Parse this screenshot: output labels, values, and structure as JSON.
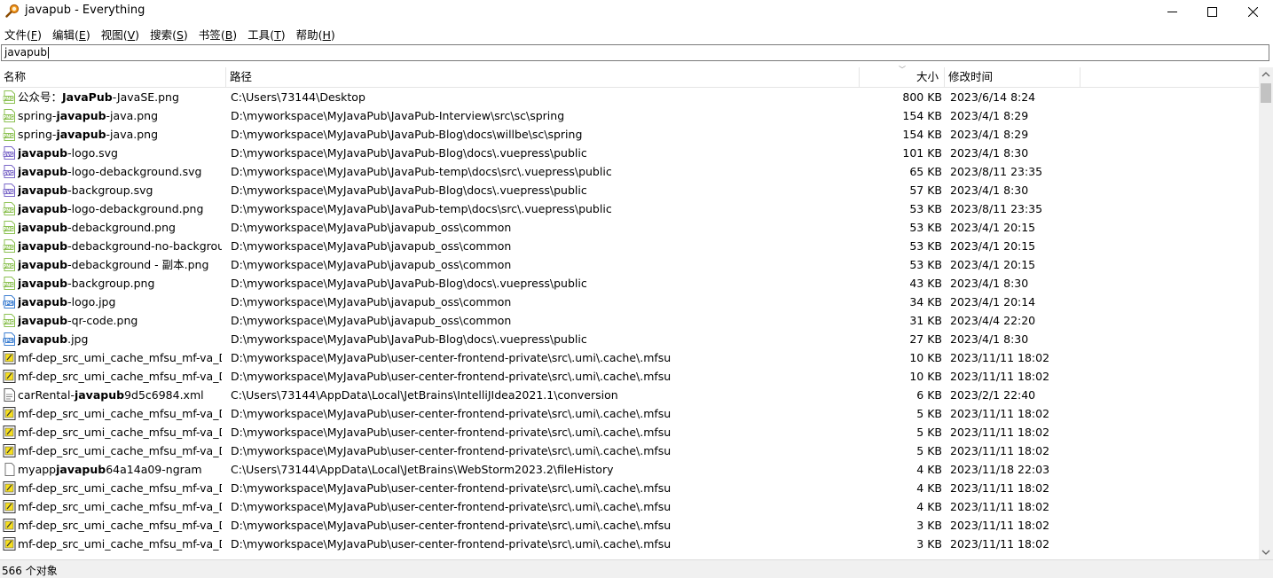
{
  "window": {
    "title": "javapub - Everything"
  },
  "menu": [
    {
      "label": "文件",
      "key": "F"
    },
    {
      "label": "编辑",
      "key": "E"
    },
    {
      "label": "视图",
      "key": "V"
    },
    {
      "label": "搜索",
      "key": "S"
    },
    {
      "label": "书签",
      "key": "B"
    },
    {
      "label": "工具",
      "key": "T"
    },
    {
      "label": "帮助",
      "key": "H"
    }
  ],
  "search": {
    "value": "javapub"
  },
  "columns": {
    "name": "名称",
    "path": "路径",
    "size": "大小",
    "modified": "修改时间"
  },
  "rows": [
    {
      "icon": "png",
      "pre": "公众号：",
      "hl": "JavaPub",
      "post": "-JavaSE.png",
      "path": "C:\\Users\\73144\\Desktop",
      "size": "800 KB",
      "date": "2023/6/14 8:24"
    },
    {
      "icon": "png",
      "pre": "spring-",
      "hl": "javapub",
      "post": "-java.png",
      "path": "D:\\myworkspace\\MyJavaPub\\JavaPub-Interview\\src\\sc\\spring",
      "size": "154 KB",
      "date": "2023/4/1 8:29"
    },
    {
      "icon": "png",
      "pre": "spring-",
      "hl": "javapub",
      "post": "-java.png",
      "path": "D:\\myworkspace\\MyJavaPub\\JavaPub-Blog\\docs\\willbe\\sc\\spring",
      "size": "154 KB",
      "date": "2023/4/1 8:29"
    },
    {
      "icon": "svg",
      "pre": "",
      "hl": "javapub",
      "post": "-logo.svg",
      "path": "D:\\myworkspace\\MyJavaPub\\JavaPub-Blog\\docs\\.vuepress\\public",
      "size": "101 KB",
      "date": "2023/4/1 8:30"
    },
    {
      "icon": "svg",
      "pre": "",
      "hl": "javapub",
      "post": "-logo-debackground.svg",
      "path": "D:\\myworkspace\\MyJavaPub\\JavaPub-temp\\docs\\src\\.vuepress\\public",
      "size": "65 KB",
      "date": "2023/8/11 23:35"
    },
    {
      "icon": "svg",
      "pre": "",
      "hl": "javapub",
      "post": "-backgroup.svg",
      "path": "D:\\myworkspace\\MyJavaPub\\JavaPub-Blog\\docs\\.vuepress\\public",
      "size": "57 KB",
      "date": "2023/4/1 8:30"
    },
    {
      "icon": "png",
      "pre": "",
      "hl": "javapub",
      "post": "-logo-debackground.png",
      "path": "D:\\myworkspace\\MyJavaPub\\JavaPub-temp\\docs\\src\\.vuepress\\public",
      "size": "53 KB",
      "date": "2023/8/11 23:35"
    },
    {
      "icon": "png",
      "pre": "",
      "hl": "javapub",
      "post": "-debackground.png",
      "path": "D:\\myworkspace\\MyJavaPub\\javapub_oss\\common",
      "size": "53 KB",
      "date": "2023/4/1 20:15"
    },
    {
      "icon": "png",
      "pre": "",
      "hl": "javapub",
      "post": "-debackground-no-backgrou…",
      "path": "D:\\myworkspace\\MyJavaPub\\javapub_oss\\common",
      "size": "53 KB",
      "date": "2023/4/1 20:15"
    },
    {
      "icon": "png",
      "pre": "",
      "hl": "javapub",
      "post": "-debackground - 副本.png",
      "path": "D:\\myworkspace\\MyJavaPub\\javapub_oss\\common",
      "size": "53 KB",
      "date": "2023/4/1 20:15"
    },
    {
      "icon": "png",
      "pre": "",
      "hl": "javapub",
      "post": "-backgroup.png",
      "path": "D:\\myworkspace\\MyJavaPub\\JavaPub-Blog\\docs\\.vuepress\\public",
      "size": "43 KB",
      "date": "2023/4/1 8:30"
    },
    {
      "icon": "jpg",
      "pre": "",
      "hl": "javapub",
      "post": "-logo.jpg",
      "path": "D:\\myworkspace\\MyJavaPub\\javapub_oss\\common",
      "size": "34 KB",
      "date": "2023/4/1 20:14"
    },
    {
      "icon": "png",
      "pre": "",
      "hl": "javapub",
      "post": "-qr-code.png",
      "path": "D:\\myworkspace\\MyJavaPub\\javapub_oss\\common",
      "size": "31 KB",
      "date": "2023/4/4 22:20"
    },
    {
      "icon": "jpg",
      "pre": "",
      "hl": "javapub",
      "post": ".jpg",
      "path": "D:\\myworkspace\\MyJavaPub\\JavaPub-Blog\\docs\\.vuepress\\public",
      "size": "27 KB",
      "date": "2023/4/1 8:30"
    },
    {
      "icon": "js",
      "pre": "mf-dep_src_umi_cache_mfsu_mf-va_D_…",
      "hl": "",
      "post": "",
      "path": "D:\\myworkspace\\MyJavaPub\\user-center-frontend-private\\src\\.umi\\.cache\\.mfsu",
      "size": "10 KB",
      "date": "2023/11/11 18:02"
    },
    {
      "icon": "js",
      "pre": "mf-dep_src_umi_cache_mfsu_mf-va_D_…",
      "hl": "",
      "post": "",
      "path": "D:\\myworkspace\\MyJavaPub\\user-center-frontend-private\\src\\.umi\\.cache\\.mfsu",
      "size": "10 KB",
      "date": "2023/11/11 18:02"
    },
    {
      "icon": "xml",
      "pre": "carRental-",
      "hl": "javapub",
      "post": "9d5c6984.xml",
      "path": "C:\\Users\\73144\\AppData\\Local\\JetBrains\\IntelliJIdea2021.1\\conversion",
      "size": "6 KB",
      "date": "2023/2/1 22:40"
    },
    {
      "icon": "js",
      "pre": "mf-dep_src_umi_cache_mfsu_mf-va_D_…",
      "hl": "",
      "post": "",
      "path": "D:\\myworkspace\\MyJavaPub\\user-center-frontend-private\\src\\.umi\\.cache\\.mfsu",
      "size": "5 KB",
      "date": "2023/11/11 18:02"
    },
    {
      "icon": "js",
      "pre": "mf-dep_src_umi_cache_mfsu_mf-va_D_…",
      "hl": "",
      "post": "",
      "path": "D:\\myworkspace\\MyJavaPub\\user-center-frontend-private\\src\\.umi\\.cache\\.mfsu",
      "size": "5 KB",
      "date": "2023/11/11 18:02"
    },
    {
      "icon": "js",
      "pre": "mf-dep_src_umi_cache_mfsu_mf-va_D_…",
      "hl": "",
      "post": "",
      "path": "D:\\myworkspace\\MyJavaPub\\user-center-frontend-private\\src\\.umi\\.cache\\.mfsu",
      "size": "5 KB",
      "date": "2023/11/11 18:02"
    },
    {
      "icon": "file",
      "pre": "myapp",
      "hl": "javapub",
      "post": "64a14a09-ngram",
      "path": "C:\\Users\\73144\\AppData\\Local\\JetBrains\\WebStorm2023.2\\fileHistory",
      "size": "4 KB",
      "date": "2023/11/18 22:03"
    },
    {
      "icon": "js",
      "pre": "mf-dep_src_umi_cache_mfsu_mf-va_D_…",
      "hl": "",
      "post": "",
      "path": "D:\\myworkspace\\MyJavaPub\\user-center-frontend-private\\src\\.umi\\.cache\\.mfsu",
      "size": "4 KB",
      "date": "2023/11/11 18:02"
    },
    {
      "icon": "js",
      "pre": "mf-dep_src_umi_cache_mfsu_mf-va_D_…",
      "hl": "",
      "post": "",
      "path": "D:\\myworkspace\\MyJavaPub\\user-center-frontend-private\\src\\.umi\\.cache\\.mfsu",
      "size": "4 KB",
      "date": "2023/11/11 18:02"
    },
    {
      "icon": "js",
      "pre": "mf-dep_src_umi_cache_mfsu_mf-va_D_…",
      "hl": "",
      "post": "",
      "path": "D:\\myworkspace\\MyJavaPub\\user-center-frontend-private\\src\\.umi\\.cache\\.mfsu",
      "size": "3 KB",
      "date": "2023/11/11 18:02"
    },
    {
      "icon": "js",
      "pre": "mf-dep_src_umi_cache_mfsu_mf-va_D_…",
      "hl": "",
      "post": "",
      "path": "D:\\myworkspace\\MyJavaPub\\user-center-frontend-private\\src\\.umi\\.cache\\.mfsu",
      "size": "3 KB",
      "date": "2023/11/11 18:02"
    }
  ],
  "status": {
    "text": "566 个对象"
  },
  "colors": {
    "png": "#8cc152",
    "svg": "#7b68c8",
    "jpg": "#3d7fd1"
  }
}
